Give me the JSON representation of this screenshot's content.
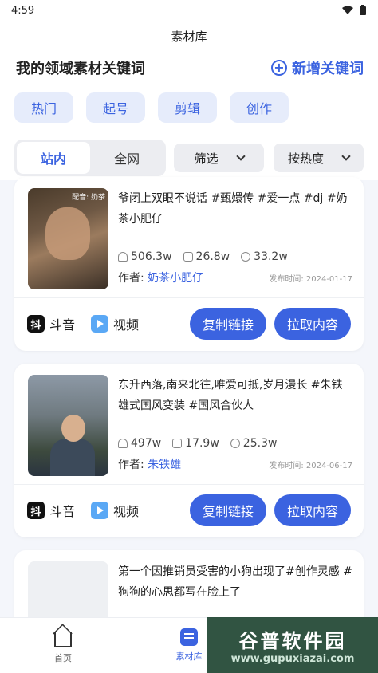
{
  "status": {
    "time": "4:59"
  },
  "topbar": {
    "title": "素材库"
  },
  "section": {
    "title": "我的领域素材关键词",
    "add_label": "新增关键词"
  },
  "chips": [
    "热门",
    "起号",
    "剪辑",
    "创作"
  ],
  "segment": {
    "active": "站内",
    "inactive": "全网"
  },
  "filters": {
    "filter_label": "筛选",
    "sort_label": "按热度"
  },
  "cards": [
    {
      "desc": "爷闭上双眼不说话 #甄嬛传 #爱一点 #dj #奶茶小肥仔",
      "thumb_caption": "配音: 奶茶",
      "likes": "506.3w",
      "comments": "26.8w",
      "shares": "33.2w",
      "author_label": "作者:",
      "author": "奶茶小肥仔",
      "pubtime": "发布时间: 2024-01-17",
      "platform": "斗音",
      "type": "视频",
      "copy_btn": "复制链接",
      "pull_btn": "拉取内容"
    },
    {
      "desc": "东升西落,南来北往,唯爱可抵,岁月漫长 #朱铁雄式国风变装 #国风合伙人",
      "thumb_caption": "",
      "likes": "497w",
      "comments": "17.9w",
      "shares": "25.3w",
      "author_label": "作者:",
      "author": "朱铁雄",
      "pubtime": "发布时间: 2024-06-17",
      "platform": "斗音",
      "type": "视频",
      "copy_btn": "复制链接",
      "pull_btn": "拉取内容"
    },
    {
      "desc": "第一个因推销员受害的小狗出现了#创作灵感 #狗狗的心思都写在脸上了"
    }
  ],
  "tabbar": {
    "home": "首页",
    "library": "素材库"
  },
  "watermark": {
    "title": "谷普软件园",
    "url": "www.gupuxiazai.com"
  },
  "colors": {
    "accent": "#3b63e0",
    "chip_bg": "#e6ecfb"
  }
}
